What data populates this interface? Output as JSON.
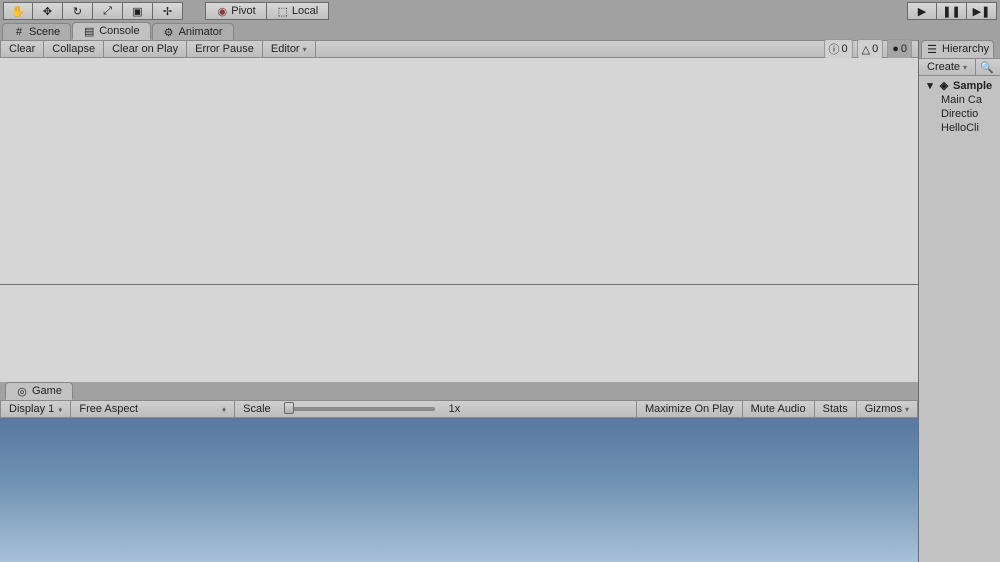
{
  "toolbar": {
    "pivot_label": "Pivot",
    "local_label": "Local"
  },
  "tabs": {
    "scene": "Scene",
    "console": "Console",
    "animator": "Animator",
    "game": "Game",
    "hierarchy": "Hierarchy"
  },
  "console": {
    "clear": "Clear",
    "collapse": "Collapse",
    "clear_on_play": "Clear on Play",
    "error_pause": "Error Pause",
    "editor": "Editor",
    "info_count": "0",
    "warn_count": "0",
    "error_count": "0"
  },
  "game": {
    "display": "Display 1",
    "aspect": "Free Aspect",
    "scale_label": "Scale",
    "scale_value": "1x",
    "maximize": "Maximize On Play",
    "mute": "Mute Audio",
    "stats": "Stats",
    "gizmos": "Gizmos"
  },
  "hierarchy": {
    "create": "Create",
    "scene_name": "Sample",
    "items": [
      "Main Ca",
      "Directio",
      "HelloCli"
    ]
  }
}
